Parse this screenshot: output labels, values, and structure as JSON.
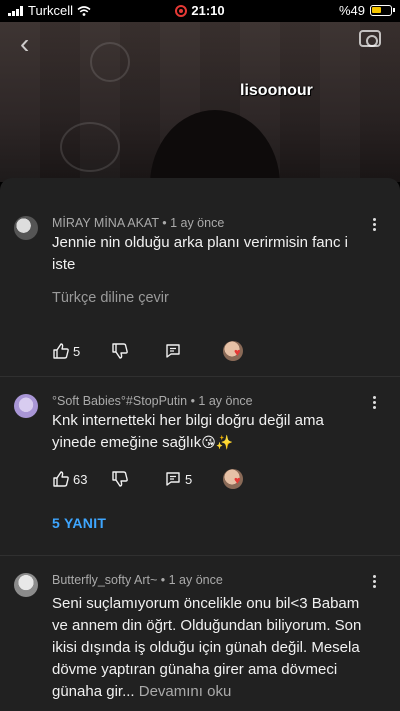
{
  "status_bar": {
    "carrier": "Turkcell",
    "time": "21:10",
    "battery": "%49"
  },
  "video": {
    "watermark": "lisoonour",
    "icons": [
      "back-chevron-icon",
      "camera-icon"
    ]
  },
  "comments": [
    {
      "author": "MİRAY MİNA AKAT",
      "age": "1 ay önce",
      "text": "Jennie nin olduğu arka planı verirmisin fanc i iste",
      "translate": "Türkçe diline çevir",
      "likes": "5"
    },
    {
      "author": "°Soft Babies°#StopPutin",
      "age": "1 ay önce",
      "text_line1": "Knk internetteki her bilgi doğru değil ama",
      "text_line2": "yinede emeğine sağlık",
      "emojis": "😘✨",
      "likes": "63",
      "reply_count": "5",
      "replies_label": "5 YANIT"
    },
    {
      "author": "Butterfly_softy Art~",
      "age": "1 ay önce",
      "text": "Seni suçlamıyorum öncelikle onu bil<3 Babam ve annem din öğrt. Olduğundan biliyorum. Son ikisi dışında iş olduğu için günah değil. Mesela dövme yaptıran günaha girer ama dövmeci günaha gir...",
      "read_more": "Devamını oku"
    }
  ],
  "colors": {
    "background": "#212121",
    "link": "#3ea6ff",
    "meta": "#aaaaaa"
  }
}
